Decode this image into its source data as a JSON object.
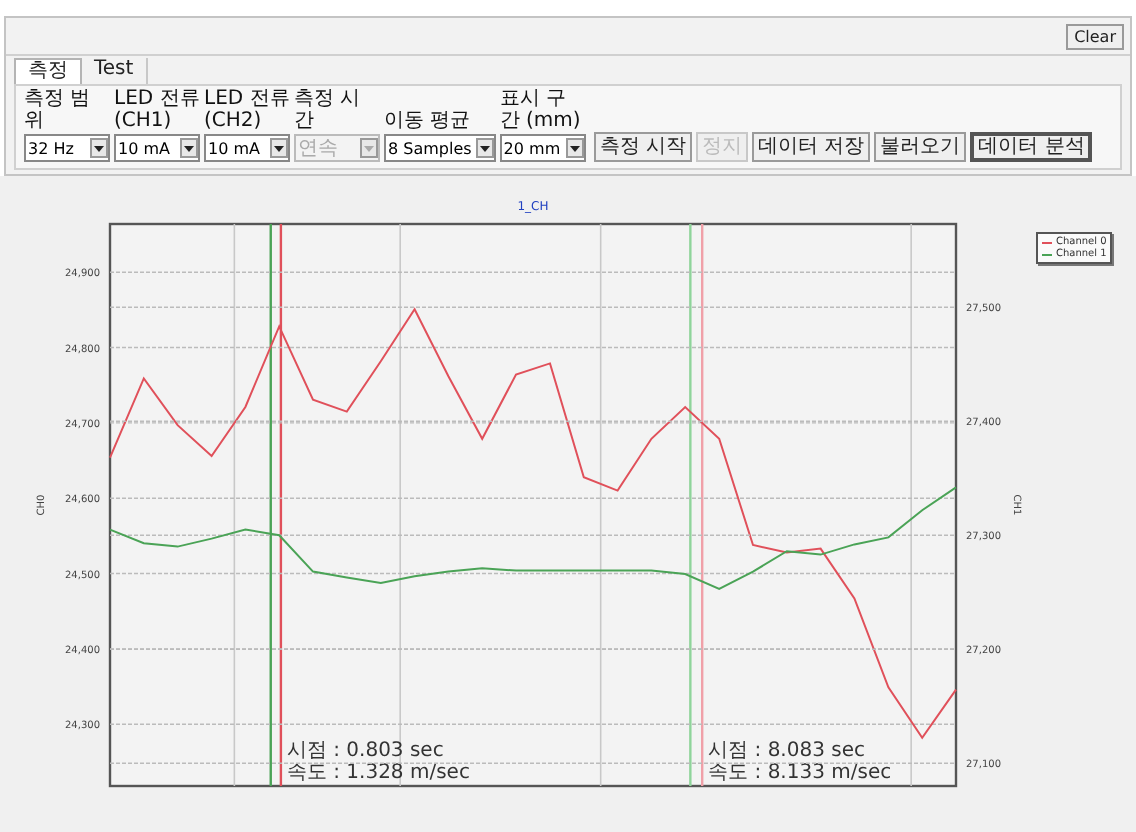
{
  "toolbar": {
    "clear_button": "Clear"
  },
  "tabs": [
    {
      "label": "측정",
      "selected": true
    },
    {
      "label": "Test",
      "selected": false
    }
  ],
  "controls": [
    {
      "label": "측정 범위",
      "value": "32 Hz",
      "disabled": false
    },
    {
      "label": "LED 전류 (CH1)",
      "value": "10 mA",
      "disabled": false
    },
    {
      "label": "LED 전류 (CH2)",
      "value": "10 mA",
      "disabled": false
    },
    {
      "label": "측정 시간",
      "value": "연속",
      "disabled": true
    },
    {
      "label": "이동 평균",
      "value": "8 Samples",
      "disabled": false
    },
    {
      "label": "표시 구간 (mm)",
      "value": "20 mm",
      "disabled": false
    }
  ],
  "buttons": [
    {
      "label": "측정 시작",
      "disabled": false,
      "pressed": false
    },
    {
      "label": "정지",
      "disabled": true,
      "pressed": false
    },
    {
      "label": "데이터 저장",
      "disabled": false,
      "pressed": false
    },
    {
      "label": "불러오기",
      "disabled": false,
      "pressed": false
    },
    {
      "label": "데이터 분석",
      "disabled": false,
      "pressed": true
    }
  ],
  "chart": {
    "title": "1_CH",
    "chart_data": {
      "type": "line",
      "ylabel": "CH0",
      "grid": true,
      "categories": [
        null,
        null,
        null,
        null,
        null,
        null,
        null,
        null,
        null,
        null,
        null,
        null,
        null,
        null,
        null,
        null,
        null,
        null,
        null,
        null,
        null,
        null,
        null,
        null,
        null,
        null
      ],
      "ylim": [
        24218,
        24964
      ],
      "yticks": [
        {
          "value": 24900,
          "label": "24,900"
        },
        {
          "value": 24800,
          "label": "24,800"
        },
        {
          "value": 24700,
          "label": "24,700"
        },
        {
          "value": 24600,
          "label": "24,600"
        },
        {
          "value": 24500,
          "label": "24,500"
        },
        {
          "value": 24400,
          "label": "24,400"
        },
        {
          "value": 24300,
          "label": "24,300"
        }
      ],
      "series": [
        {
          "name": "Channel 0",
          "color": "#e0505a",
          "values": [
            24654,
            24759,
            24697,
            24656,
            24721,
            24828,
            24731,
            24715,
            24782,
            24851,
            24762,
            24679,
            24764,
            24779,
            24628,
            24610,
            24679,
            24721,
            24679,
            24538,
            24528,
            24533,
            24467,
            24349,
            24282,
            24346
          ]
        }
      ]
    },
    "overlay_chart": {
      "chart_data": {
        "type": "line",
        "ylabel": "CH1",
        "grid": true,
        "categories": [
          null,
          null,
          null,
          null,
          null,
          null,
          null,
          null,
          null,
          null,
          null,
          null,
          null,
          null,
          null,
          null,
          null,
          null,
          null,
          null,
          null,
          null,
          null,
          null,
          null,
          null
        ],
        "ylim": [
          27080,
          27573
        ],
        "yticks": [
          {
            "value": 27500,
            "label": "27,500"
          },
          {
            "value": 27400,
            "label": "27,400"
          },
          {
            "value": 27300,
            "label": "27,300"
          },
          {
            "value": 27200,
            "label": "27,200"
          },
          {
            "value": 27100,
            "label": "27,100"
          }
        ],
        "series": [
          {
            "name": "Channel 1",
            "color": "#4aa356",
            "values": [
              27305,
              27293,
              27290,
              27297,
              27305,
              27300,
              27268,
              27263,
              27258,
              27264,
              27268,
              27271,
              27269,
              27269,
              27269,
              27269,
              27269,
              27266,
              27253,
              27268,
              27286,
              27283,
              27292,
              27298,
              27322,
              27342
            ]
          }
        ]
      }
    },
    "cursor_lines": [
      {
        "color": "#4aa356"
      },
      {
        "color": "#e0505a"
      },
      {
        "color": "#8fd49a"
      },
      {
        "color": "#f0a0a8"
      }
    ],
    "readouts": [
      {
        "lines": [
          "시점 : 0.803 sec",
          "속도 : 1.328 m/sec"
        ]
      },
      {
        "lines": [
          "시점 : 8.083 sec",
          "속도 : 8.133 m/sec"
        ]
      }
    ]
  }
}
